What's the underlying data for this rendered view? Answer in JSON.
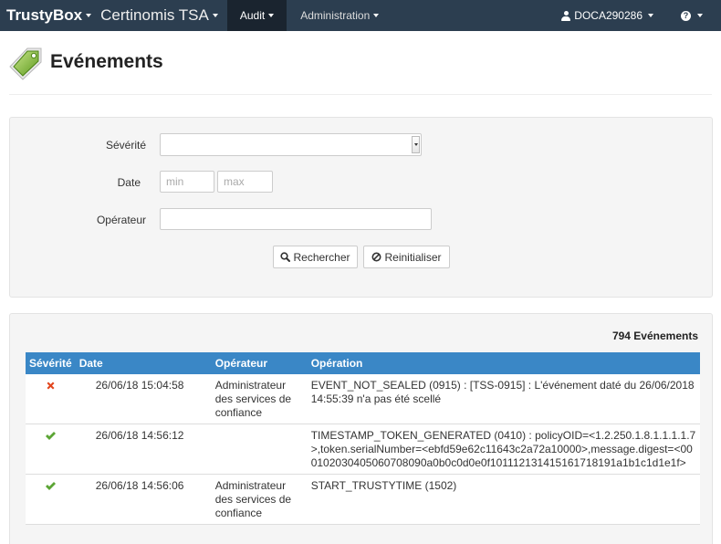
{
  "navbar": {
    "brand": "TrustyBox",
    "product": "Certinomis TSA",
    "menu_audit": "Audit",
    "menu_admin": "Administration",
    "user": "DOCA290286",
    "help_glyph": "?",
    "icons": [
      "tag-icon",
      "user-icon",
      "help-icon",
      "search-icon",
      "ban-icon",
      "error-x-icon",
      "success-check-icon"
    ]
  },
  "page": {
    "title": "Evénements"
  },
  "filters": {
    "severity_label": "Sévérité",
    "severity_value": "",
    "date_label": "Date",
    "date_min_placeholder": "min",
    "date_max_placeholder": "max",
    "operator_label": "Opérateur",
    "operator_value": "",
    "search_button": "Rechercher",
    "reset_button": "Reinitialiser"
  },
  "results": {
    "count_text": "794 Evénements",
    "columns": [
      "Sévérité",
      "Date",
      "Opérateur",
      "Opération"
    ],
    "rows": [
      {
        "severity": "error",
        "date": "26/06/18 15:04:58",
        "operator": "Administrateur des services de confiance",
        "operation": "EVENT_NOT_SEALED (0915) : [TSS-0915] : L'événement daté du 26/06/2018 14:55:39 n'a pas été scellé"
      },
      {
        "severity": "success",
        "date": "26/06/18 14:56:12",
        "operator": "",
        "operation": "TIMESTAMP_TOKEN_GENERATED (0410) : policyOID=<1.2.250.1.8.1.1.1.1.7>,token.serialNumber=<ebfd59e62c11643c2a72a10000>,message.digest=<000102030405060708090a0b0c0d0e0f101112131415161718191a1b1c1d1e1f>"
      },
      {
        "severity": "success",
        "date": "26/06/18 14:56:06",
        "operator": "Administrateur des services de confiance",
        "operation": "START_TRUSTYTIME (1502)"
      }
    ]
  },
  "colors": {
    "navbar_bg": "#2c3e50",
    "navbar_active_bg": "#1a242f",
    "table_header_bg": "#3a87c6",
    "error_red": "#e2461e",
    "success_green": "#5ba534"
  }
}
